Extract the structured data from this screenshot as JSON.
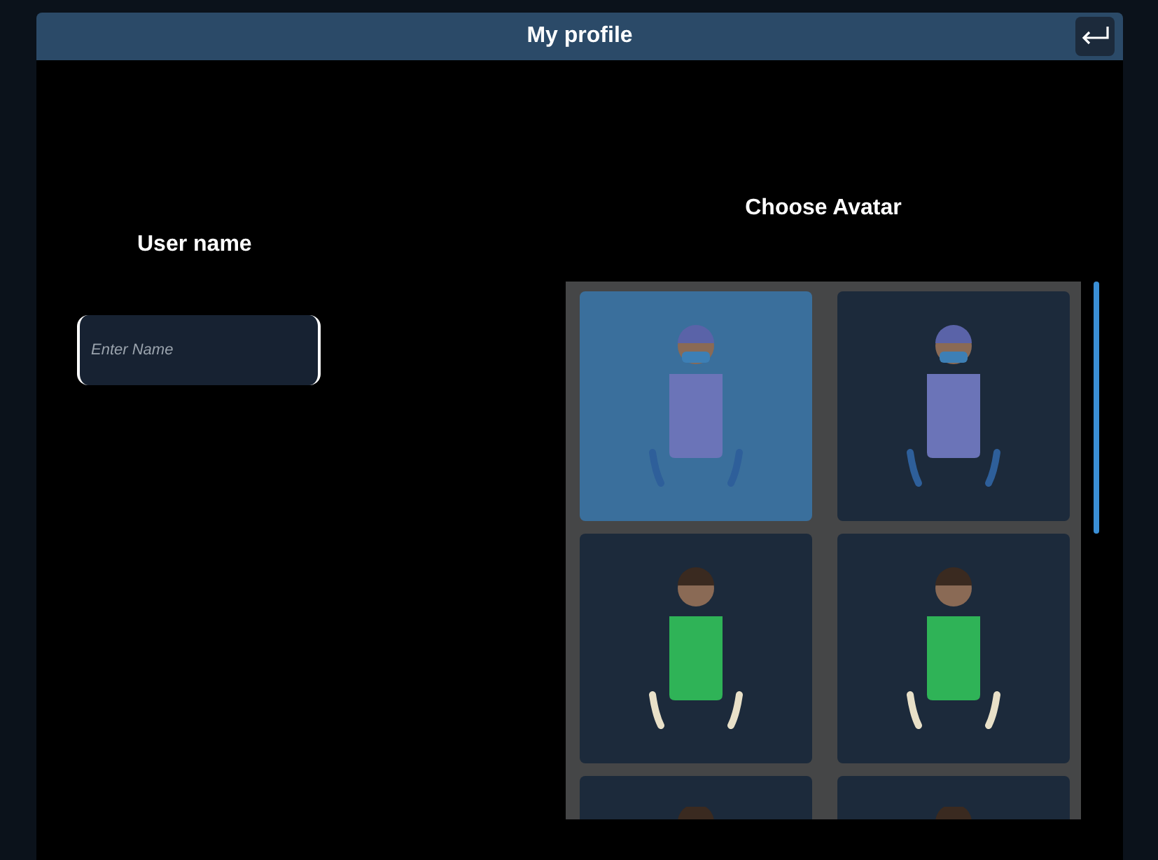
{
  "window": {
    "title": "My profile"
  },
  "user_name": {
    "label": "User name",
    "placeholder": "Enter Name"
  },
  "avatar_picker": {
    "title": "Choose Avatar",
    "avatars": [
      {
        "selected": true,
        "color": "#6b74b8",
        "mask": true
      },
      {
        "selected": false,
        "color": "#6b74b8",
        "mask": true
      },
      {
        "selected": false,
        "color": "#2fb357",
        "mask": false
      },
      {
        "selected": false,
        "color": "#2fb357",
        "mask": false
      },
      {
        "selected": false
      },
      {
        "selected": false
      }
    ]
  }
}
